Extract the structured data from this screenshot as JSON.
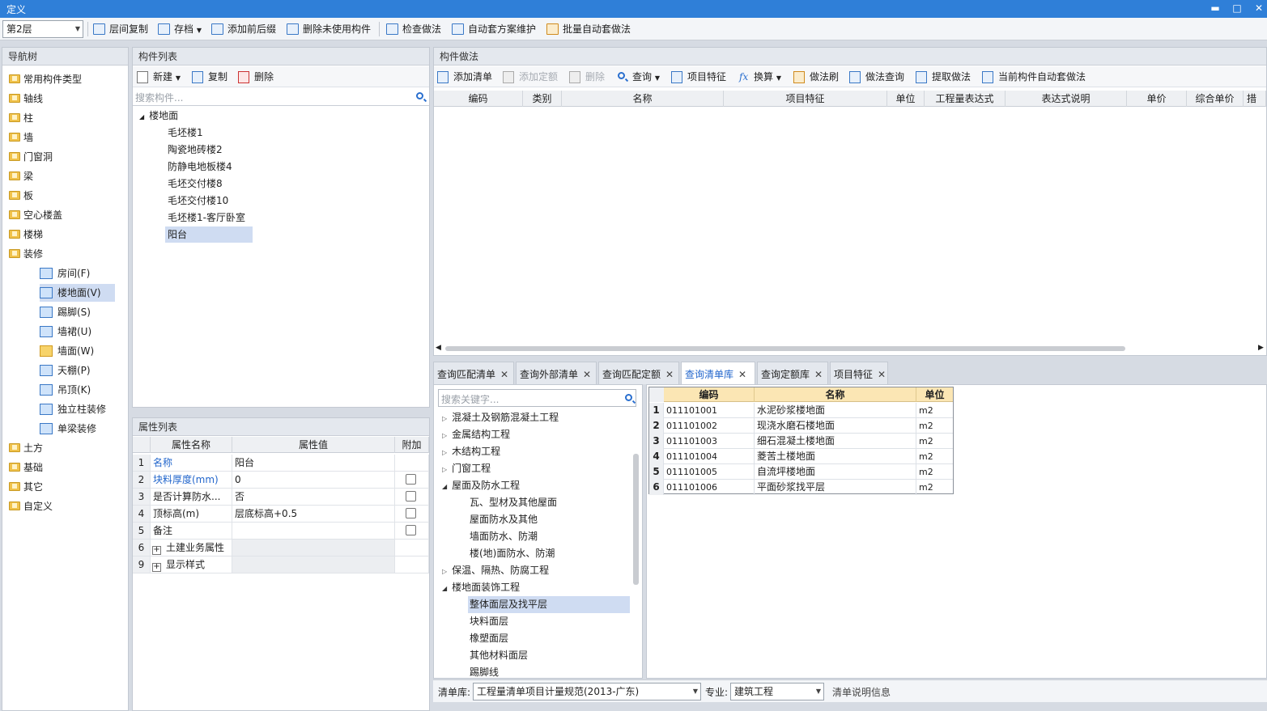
{
  "window": {
    "title": "定义",
    "min": "▬",
    "max": "□",
    "close": "✕"
  },
  "toolbar": {
    "floor": "第2层",
    "items": [
      "层间复制",
      "存档",
      "添加前后缀",
      "删除未使用构件",
      "检查做法",
      "自动套方案维护",
      "批量自动套做法"
    ]
  },
  "nav": {
    "title": "导航树",
    "items": [
      "常用构件类型",
      "轴线",
      "柱",
      "墙",
      "门窗洞",
      "梁",
      "板",
      "空心楼盖",
      "楼梯",
      "装修"
    ],
    "sub": [
      "房间(F)",
      "楼地面(V)",
      "踢脚(S)",
      "墙裙(U)",
      "墙面(W)",
      "天棚(P)",
      "吊顶(K)",
      "独立柱装修",
      "单梁装修"
    ],
    "after": [
      "土方",
      "基础",
      "其它",
      "自定义"
    ]
  },
  "components": {
    "title": "构件列表",
    "new": "新建",
    "copy": "复制",
    "delete": "删除",
    "search_placeholder": "搜索构件...",
    "root": "楼地面",
    "items": [
      "毛坯楼1",
      "陶瓷地砖楼2",
      "防静电地板楼4",
      "毛坯交付楼8",
      "毛坯交付楼10",
      "毛坯楼1-客厅卧室",
      "阳台"
    ]
  },
  "props": {
    "title": "属性列表",
    "headers": [
      "属性名称",
      "属性值",
      "附加"
    ],
    "rows": [
      {
        "n": "1",
        "name": "名称",
        "value": "阳台"
      },
      {
        "n": "2",
        "name": "块料厚度(mm)",
        "value": "0"
      },
      {
        "n": "3",
        "name": "是否计算防水...",
        "value": "否"
      },
      {
        "n": "4",
        "name": "顶标高(m)",
        "value": "层底标高+0.5"
      },
      {
        "n": "5",
        "name": "备注",
        "value": ""
      },
      {
        "n": "6",
        "name": "土建业务属性",
        "value": ""
      },
      {
        "n": "9",
        "name": "显示样式",
        "value": ""
      }
    ]
  },
  "method": {
    "title": "构件做法",
    "tools": [
      "添加清单",
      "添加定额",
      "删除",
      "查询",
      "项目特征",
      "换算",
      "做法刷",
      "做法查询",
      "提取做法",
      "当前构件自动套做法"
    ],
    "headers": [
      "编码",
      "类别",
      "名称",
      "项目特征",
      "单位",
      "工程量表达式",
      "表达式说明",
      "单价",
      "综合单价",
      "措施"
    ]
  },
  "tabs": [
    "查询匹配清单",
    "查询外部清单",
    "查询匹配定额",
    "查询清单库",
    "查询定额库",
    "项目特征"
  ],
  "lib": {
    "search_placeholder": "搜索关键字...",
    "tree": [
      "混凝土及钢筋混凝土工程",
      "金属结构工程",
      "木结构工程",
      "门窗工程",
      "屋面及防水工程",
      "瓦、型材及其他屋面",
      "屋面防水及其他",
      "墙面防水、防潮",
      "楼(地)面防水、防潮",
      "保温、隔热、防腐工程",
      "楼地面装饰工程",
      "整体面层及找平层",
      "块料面层",
      "橡塑面层",
      "其他材料面层",
      "踢脚线"
    ],
    "headers": [
      "编码",
      "名称",
      "单位"
    ],
    "rows": [
      {
        "n": "1",
        "code": "011101001",
        "name": "水泥砂浆楼地面",
        "unit": "m2"
      },
      {
        "n": "2",
        "code": "011101002",
        "name": "现浇水磨石楼地面",
        "unit": "m2"
      },
      {
        "n": "3",
        "code": "011101003",
        "name": "细石混凝土楼地面",
        "unit": "m2"
      },
      {
        "n": "4",
        "code": "011101004",
        "name": "菱苦土楼地面",
        "unit": "m2"
      },
      {
        "n": "5",
        "code": "011101005",
        "name": "自流坪楼地面",
        "unit": "m2"
      },
      {
        "n": "6",
        "code": "011101006",
        "name": "平面砂浆找平层",
        "unit": "m2"
      }
    ],
    "lib_label": "清单库:",
    "lib_value": "工程量清单项目计量规范(2013-广东)",
    "major_label": "专业:",
    "major_value": "建筑工程",
    "info": "清单说明信息"
  }
}
